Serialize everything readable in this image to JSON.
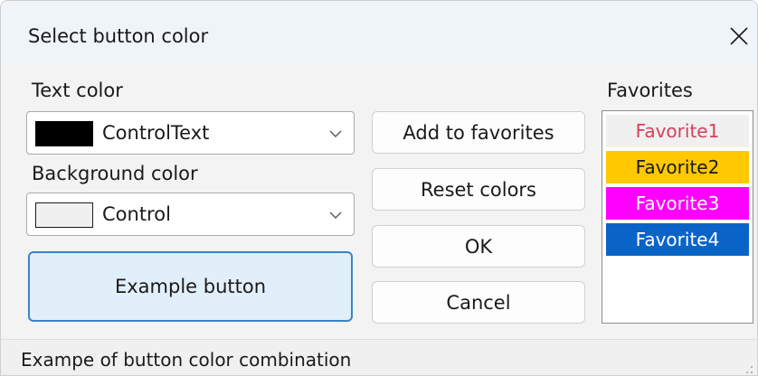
{
  "window": {
    "title": "Select button color"
  },
  "text_color": {
    "label": "Text color",
    "selected": "ControlText",
    "swatch_color": "#000000"
  },
  "background_color": {
    "label": "Background color",
    "selected": "Control",
    "swatch_color": "#f0f0f0"
  },
  "example_button": {
    "label": "Example button",
    "background": "#e1effa",
    "border": "#3c83c8"
  },
  "buttons": {
    "add_to_favorites": "Add to favorites",
    "reset_colors": "Reset colors",
    "ok": "OK",
    "cancel": "Cancel"
  },
  "favorites": {
    "label": "Favorites",
    "items": [
      {
        "label": "Favorite1",
        "text_color": "#d6405a",
        "background": "#f0f0f0"
      },
      {
        "label": "Favorite2",
        "text_color": "#1a1a1a",
        "background": "#ffc800"
      },
      {
        "label": "Favorite3",
        "text_color": "#ffffff",
        "background": "#ff00ff"
      },
      {
        "label": "Favorite4",
        "text_color": "#ffffff",
        "background": "#0a64c8"
      }
    ]
  },
  "status_bar": {
    "text": "Exampe of button color combination"
  }
}
